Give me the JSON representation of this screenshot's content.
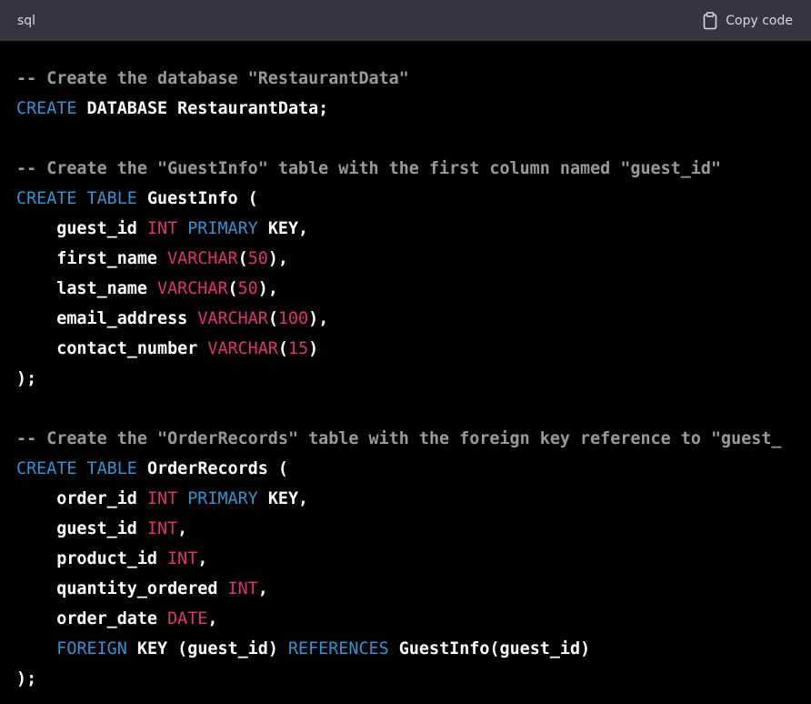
{
  "header": {
    "language": "sql",
    "copy_label": "Copy code",
    "copy_icon": "clipboard-icon"
  },
  "colors": {
    "header_bg": "#343541",
    "code_bg": "#000000",
    "keyword": "#2e95d3",
    "type": "#df3079",
    "comment": "#9a9a9a",
    "text": "#ffffff"
  },
  "code_lines": [
    [
      {
        "t": "cmt",
        "s": "-- Create the database \"RestaurantData\""
      }
    ],
    [
      {
        "t": "kw",
        "s": "CREATE"
      },
      {
        "t": "id",
        "s": " DATABASE RestaurantData;"
      }
    ],
    [],
    [
      {
        "t": "cmt",
        "s": "-- Create the \"GuestInfo\" table with the first column named \"guest_id\""
      }
    ],
    [
      {
        "t": "kw",
        "s": "CREATE"
      },
      {
        "t": "id",
        "s": " "
      },
      {
        "t": "kw",
        "s": "TABLE"
      },
      {
        "t": "id",
        "s": " GuestInfo ("
      }
    ],
    [
      {
        "t": "id",
        "s": "    guest_id "
      },
      {
        "t": "ty",
        "s": "INT"
      },
      {
        "t": "id",
        "s": " "
      },
      {
        "t": "kw",
        "s": "PRIMARY"
      },
      {
        "t": "id",
        "s": " KEY,"
      }
    ],
    [
      {
        "t": "id",
        "s": "    first_name "
      },
      {
        "t": "ty",
        "s": "VARCHAR"
      },
      {
        "t": "id",
        "s": "("
      },
      {
        "t": "num",
        "s": "50"
      },
      {
        "t": "id",
        "s": "),"
      }
    ],
    [
      {
        "t": "id",
        "s": "    last_name "
      },
      {
        "t": "ty",
        "s": "VARCHAR"
      },
      {
        "t": "id",
        "s": "("
      },
      {
        "t": "num",
        "s": "50"
      },
      {
        "t": "id",
        "s": "),"
      }
    ],
    [
      {
        "t": "id",
        "s": "    email_address "
      },
      {
        "t": "ty",
        "s": "VARCHAR"
      },
      {
        "t": "id",
        "s": "("
      },
      {
        "t": "num",
        "s": "100"
      },
      {
        "t": "id",
        "s": "),"
      }
    ],
    [
      {
        "t": "id",
        "s": "    contact_number "
      },
      {
        "t": "ty",
        "s": "VARCHAR"
      },
      {
        "t": "id",
        "s": "("
      },
      {
        "t": "num",
        "s": "15"
      },
      {
        "t": "id",
        "s": ")"
      }
    ],
    [
      {
        "t": "id",
        "s": ");"
      }
    ],
    [],
    [
      {
        "t": "cmt",
        "s": "-- Create the \"OrderRecords\" table with the foreign key reference to \"guest_"
      }
    ],
    [
      {
        "t": "kw",
        "s": "CREATE"
      },
      {
        "t": "id",
        "s": " "
      },
      {
        "t": "kw",
        "s": "TABLE"
      },
      {
        "t": "id",
        "s": " OrderRecords ("
      }
    ],
    [
      {
        "t": "id",
        "s": "    order_id "
      },
      {
        "t": "ty",
        "s": "INT"
      },
      {
        "t": "id",
        "s": " "
      },
      {
        "t": "kw",
        "s": "PRIMARY"
      },
      {
        "t": "id",
        "s": " KEY,"
      }
    ],
    [
      {
        "t": "id",
        "s": "    guest_id "
      },
      {
        "t": "ty",
        "s": "INT"
      },
      {
        "t": "id",
        "s": ","
      }
    ],
    [
      {
        "t": "id",
        "s": "    product_id "
      },
      {
        "t": "ty",
        "s": "INT"
      },
      {
        "t": "id",
        "s": ","
      }
    ],
    [
      {
        "t": "id",
        "s": "    quantity_ordered "
      },
      {
        "t": "ty",
        "s": "INT"
      },
      {
        "t": "id",
        "s": ","
      }
    ],
    [
      {
        "t": "id",
        "s": "    order_date "
      },
      {
        "t": "ty",
        "s": "DATE"
      },
      {
        "t": "id",
        "s": ","
      }
    ],
    [
      {
        "t": "id",
        "s": "    "
      },
      {
        "t": "kw",
        "s": "FOREIGN"
      },
      {
        "t": "id",
        "s": " KEY (guest_id) "
      },
      {
        "t": "kw",
        "s": "REFERENCES"
      },
      {
        "t": "id",
        "s": " GuestInfo(guest_id)"
      }
    ],
    [
      {
        "t": "id",
        "s": ");"
      }
    ]
  ]
}
